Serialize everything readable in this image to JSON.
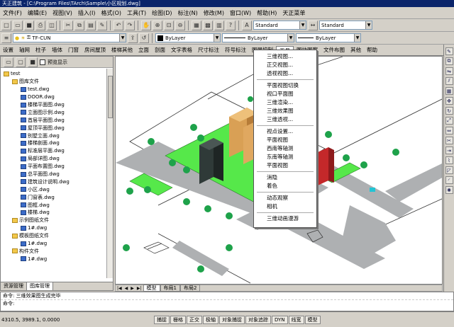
{
  "window": {
    "title": "天正建筑 - [C:\\Program Files\\TArch\\Sample\\小区规划.dwg]"
  },
  "menu": [
    "文件(F)",
    "编辑(E)",
    "视图(V)",
    "插入(I)",
    "格式(O)",
    "工具(T)",
    "绘图(D)",
    "标注(N)",
    "修改(M)",
    "窗口(W)",
    "帮助(H)",
    "天正菜单"
  ],
  "toolbar1": {
    "combo_style": "Standard",
    "combo_dimstyle": "Standard"
  },
  "toolbar2": {
    "layer_combo": "TF-CUN",
    "color_combo": "ByLayer",
    "linetype_combo": "ByLayer",
    "lineweight_combo": "ByLayer"
  },
  "ribbon_tabs": [
    "设置",
    "轴网",
    "柱子",
    "墙体",
    "门窗",
    "房间屋顶",
    "楼梯其他",
    "立面",
    "剖面",
    "文字表格",
    "尺寸标注",
    "符号标注",
    "图层控制",
    "工具",
    "图块图案",
    "文件布图",
    "其他",
    "帮助"
  ],
  "ribbon_active": "工具",
  "left_panel": {
    "checkbox_label": "预览显示",
    "tree": [
      {
        "depth": 0,
        "type": "folder",
        "label": "test"
      },
      {
        "depth": 1,
        "type": "folder",
        "label": "图库文件"
      },
      {
        "depth": 2,
        "type": "dwg",
        "label": "test.dwg"
      },
      {
        "depth": 2,
        "type": "dwg",
        "label": "DOOR.dwg"
      },
      {
        "depth": 2,
        "type": "dwg",
        "label": "楼梯平面图.dwg"
      },
      {
        "depth": 2,
        "type": "dwg",
        "label": "立面图示例.dwg"
      },
      {
        "depth": 2,
        "type": "dwg",
        "label": "首层平面图.dwg"
      },
      {
        "depth": 2,
        "type": "dwg",
        "label": "屋顶平面图.dwg"
      },
      {
        "depth": 2,
        "type": "dwg",
        "label": "别墅立面.dwg"
      },
      {
        "depth": 2,
        "type": "dwg",
        "label": "楼梯剖面.dwg"
      },
      {
        "depth": 2,
        "type": "dwg",
        "label": "标准层平面.dwg"
      },
      {
        "depth": 2,
        "type": "dwg",
        "label": "局部详图.dwg"
      },
      {
        "depth": 2,
        "type": "dwg",
        "label": "平面布置图.dwg"
      },
      {
        "depth": 2,
        "type": "dwg",
        "label": "总平面图.dwg"
      },
      {
        "depth": 2,
        "type": "dwg",
        "label": "建筑设计说明.dwg"
      },
      {
        "depth": 2,
        "type": "dwg",
        "label": "小区.dwg"
      },
      {
        "depth": 2,
        "type": "dwg",
        "label": "门窗表.dwg"
      },
      {
        "depth": 2,
        "type": "dwg",
        "label": "图框.dwg"
      },
      {
        "depth": 2,
        "type": "dwg",
        "label": "楼梯.dwg"
      },
      {
        "depth": 1,
        "type": "folder",
        "label": "示例图纸文件"
      },
      {
        "depth": 2,
        "type": "dwg",
        "label": "1#.dwg"
      },
      {
        "depth": 1,
        "type": "folder",
        "label": "模板图纸文件"
      },
      {
        "depth": 2,
        "type": "dwg",
        "label": "1#.dwg"
      },
      {
        "depth": 1,
        "type": "folder",
        "label": "构件文件"
      },
      {
        "depth": 2,
        "type": "dwg",
        "label": "1#.dwg"
      }
    ],
    "tabs": [
      "资源管理",
      "图库管理"
    ]
  },
  "context_menu": [
    "三维视图...",
    "正交视图...",
    "透视视图...",
    "sep",
    "平面视图切换",
    "视口平面图",
    "三维渲染...",
    "三维效果图",
    "三维透视...",
    "sep",
    "视点设置...",
    "平面视图",
    "西南等轴测",
    "东南等轴测",
    "平面视图",
    "sep",
    "消隐",
    "着色",
    "sep",
    "动态观察",
    "相机",
    "sep",
    "三维动画漫游"
  ],
  "layout_tabs": [
    "模型",
    "布局1",
    "布局2"
  ],
  "command": {
    "history": "命令: 三维效果图生成完毕",
    "prompt": "命令:"
  },
  "status": {
    "coords": "4310.5, 3989.1, 0.0000",
    "buttons": [
      "捕捉",
      "栅格",
      "正交",
      "极轴",
      "对象捕捉",
      "对象追踪",
      "DYN",
      "线宽",
      "模型"
    ]
  },
  "colors": {
    "title_bg": "#0a246a",
    "grass": "#56e84a",
    "road": "#aeb0b2",
    "building_dark": "#2f3a38",
    "building_orange": "#d9a055",
    "building_red": "#c4282a",
    "tree": "#1ea24a",
    "panel_bg": "#d4d0c8"
  }
}
